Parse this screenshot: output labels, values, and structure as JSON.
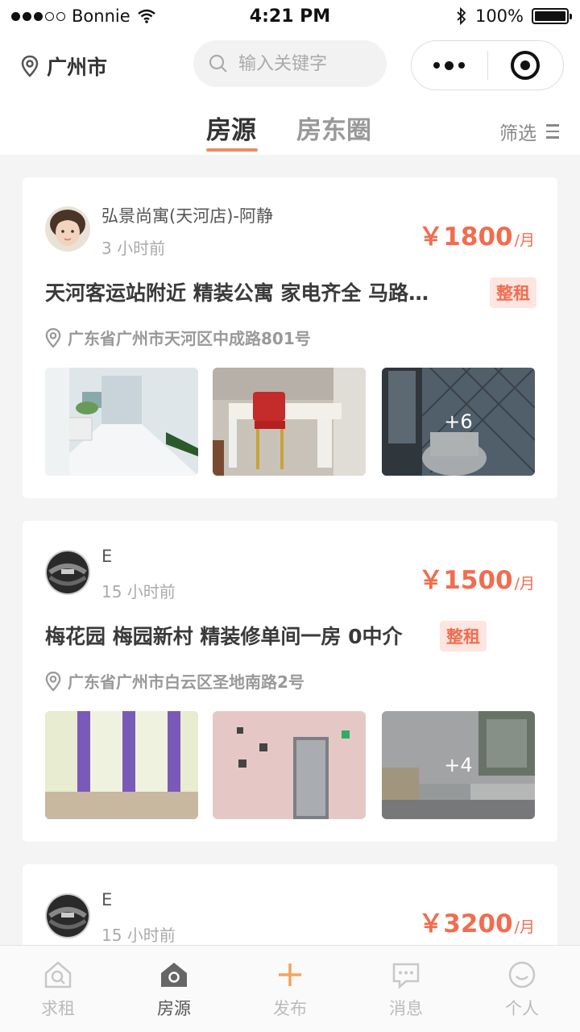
{
  "status_bar": {
    "carrier": "Bonnie",
    "time": "4:21 PM",
    "battery": "100%"
  },
  "header": {
    "city": "广州市",
    "search_placeholder": "输入关键字",
    "tabs": [
      {
        "label": "房源",
        "active": true
      },
      {
        "label": "房东圈",
        "active": false
      }
    ],
    "filter_label": "筛选"
  },
  "colors": {
    "accent": "#f26c4f",
    "tab_underline": "#f08a5d",
    "tag_bg": "#fde5e0"
  },
  "listings": [
    {
      "user": "弘景尚寓(天河店)-阿静",
      "time": "3 小时前",
      "price": "￥1800",
      "price_unit": "/月",
      "title": "天河客运站附近 精装公寓 家电齐全 马路…",
      "tag": "整租",
      "address": "广东省广州市天河区中成路801号",
      "more_photos": "+6"
    },
    {
      "user": "E",
      "time": "15 小时前",
      "price": "￥1500",
      "price_unit": "/月",
      "title": "梅花园 梅园新村 精装修单间一房 0中介",
      "tag": "整租",
      "address": "广东省广州市白云区圣地南路2号",
      "more_photos": "+4"
    },
    {
      "user": "E",
      "time": "15 小时前",
      "price": "￥3200",
      "price_unit": "/月"
    }
  ],
  "tabbar": [
    {
      "label": "求租",
      "icon": "search-house-icon",
      "active": false
    },
    {
      "label": "房源",
      "icon": "house-icon",
      "active": true
    },
    {
      "label": "发布",
      "icon": "plus-icon",
      "active": false
    },
    {
      "label": "消息",
      "icon": "message-icon",
      "active": false
    },
    {
      "label": "个人",
      "icon": "smile-icon",
      "active": false
    }
  ]
}
